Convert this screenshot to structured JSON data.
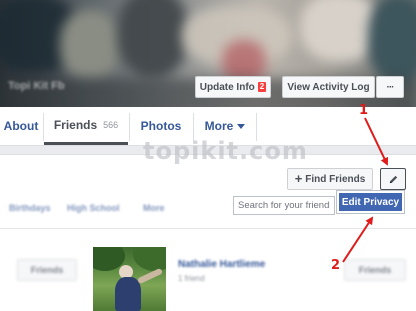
{
  "cover": {
    "name": "Topi Kit Fb",
    "update_info_label": "Update Info",
    "update_info_badge": "2",
    "activity_log_label": "View Activity Log",
    "more_label": "···"
  },
  "tabs": [
    {
      "label": "About"
    },
    {
      "label": "Friends",
      "count": "566"
    },
    {
      "label": "Photos"
    },
    {
      "label": "More"
    }
  ],
  "watermark": "topikit.com",
  "friends_panel": {
    "find_friends_label": "Find Friends",
    "search_placeholder": "Search for your friends",
    "edit_menu": {
      "item": "Edit Privacy"
    },
    "subtabs": [
      "Birthdays",
      "High School",
      "More"
    ]
  },
  "friend_row": {
    "left_button_label": "Friends",
    "name": "Nathalie Hartlieme",
    "subtitle": "1 friend",
    "right_button_label": "Friends"
  },
  "annotations": {
    "step1": "1",
    "step2": "2"
  },
  "colors": {
    "brand_blue": "#4267b2",
    "link_blue": "#365899",
    "annotation_red": "#e01b1b",
    "badge_red": "#fa3e3e"
  }
}
